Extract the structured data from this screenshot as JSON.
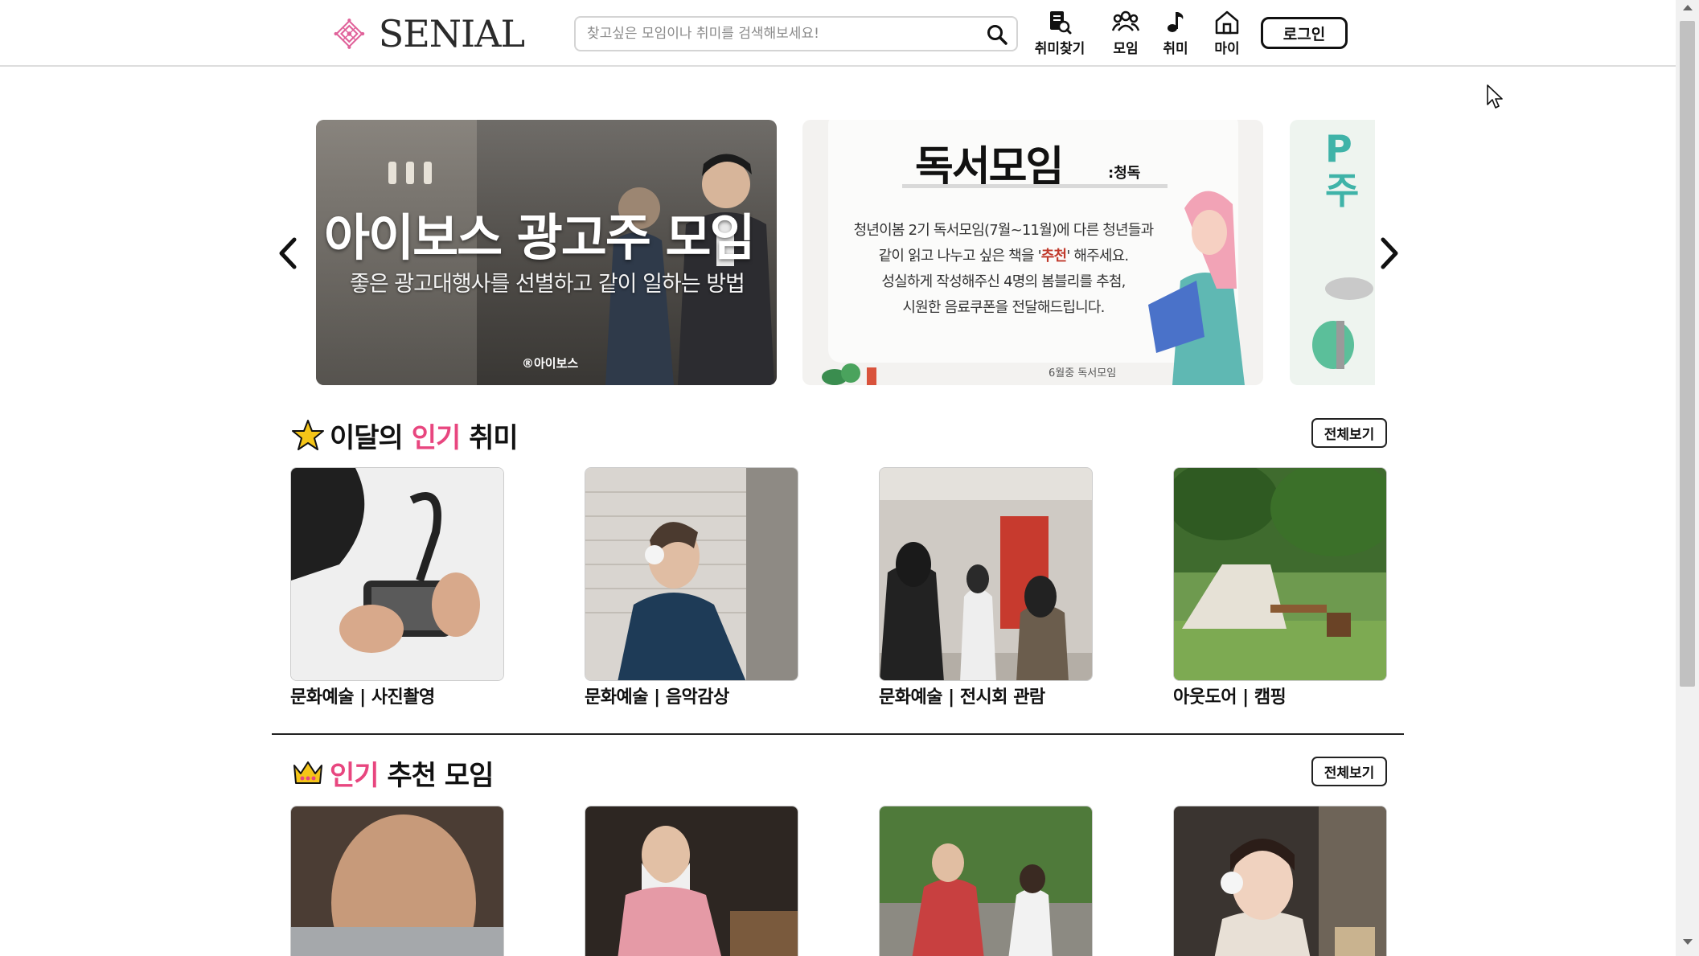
{
  "header": {
    "logo_text": "SENIAL",
    "search_placeholder": "찾고싶은 모임이나 취미를 검색해보세요!",
    "nav": [
      {
        "label": "취미찾기",
        "icon": "hobby-search-icon"
      },
      {
        "label": "모임",
        "icon": "group-icon"
      },
      {
        "label": "취미",
        "icon": "music-note-icon"
      },
      {
        "label": "마이",
        "icon": "home-icon"
      }
    ],
    "login_label": "로그인"
  },
  "carousel": {
    "slides": [
      {
        "title": "아이보스 광고주 모임",
        "subtitle": "좋은 광고대행사를 선별하고 같이 일하는 방법",
        "brand": "®아이보스"
      },
      {
        "title": "독서모임",
        "tag": ":청독",
        "body_lines": [
          "청년이봄 2기 독서모임(7월~11월)에 다른 청년들과",
          "같이 읽고 나누고 싶은 책을 ",
          "추천",
          "' 해주세요.",
          "성실하게 작성해주신 4명의 봄블리를 추첨,",
          "시원한 음료쿠폰을 전달해드립니다."
        ],
        "footnote": "6월중 독서모임"
      },
      {
        "title_lines": [
          "P",
          "주"
        ]
      }
    ],
    "prev_icon": "chevron-left-icon",
    "next_icon": "chevron-right-icon"
  },
  "popular_hobbies": {
    "title_prefix": "이달의 ",
    "title_highlight": "인기",
    "title_suffix": " 취미",
    "view_all_label": "전체보기",
    "items": [
      {
        "caption": "문화예술 | 사진촬영"
      },
      {
        "caption": "문화예술 | 음악감상"
      },
      {
        "caption": "문화예술 | 전시회 관람"
      },
      {
        "caption": "아웃도어 | 캠핑"
      }
    ]
  },
  "popular_groups": {
    "title_highlight": "인기",
    "title_suffix": " 추천 모임",
    "view_all_label": "전체보기"
  },
  "colors": {
    "accent_pink": "#e8467f",
    "slide3_teal": "#3fb3a8"
  }
}
